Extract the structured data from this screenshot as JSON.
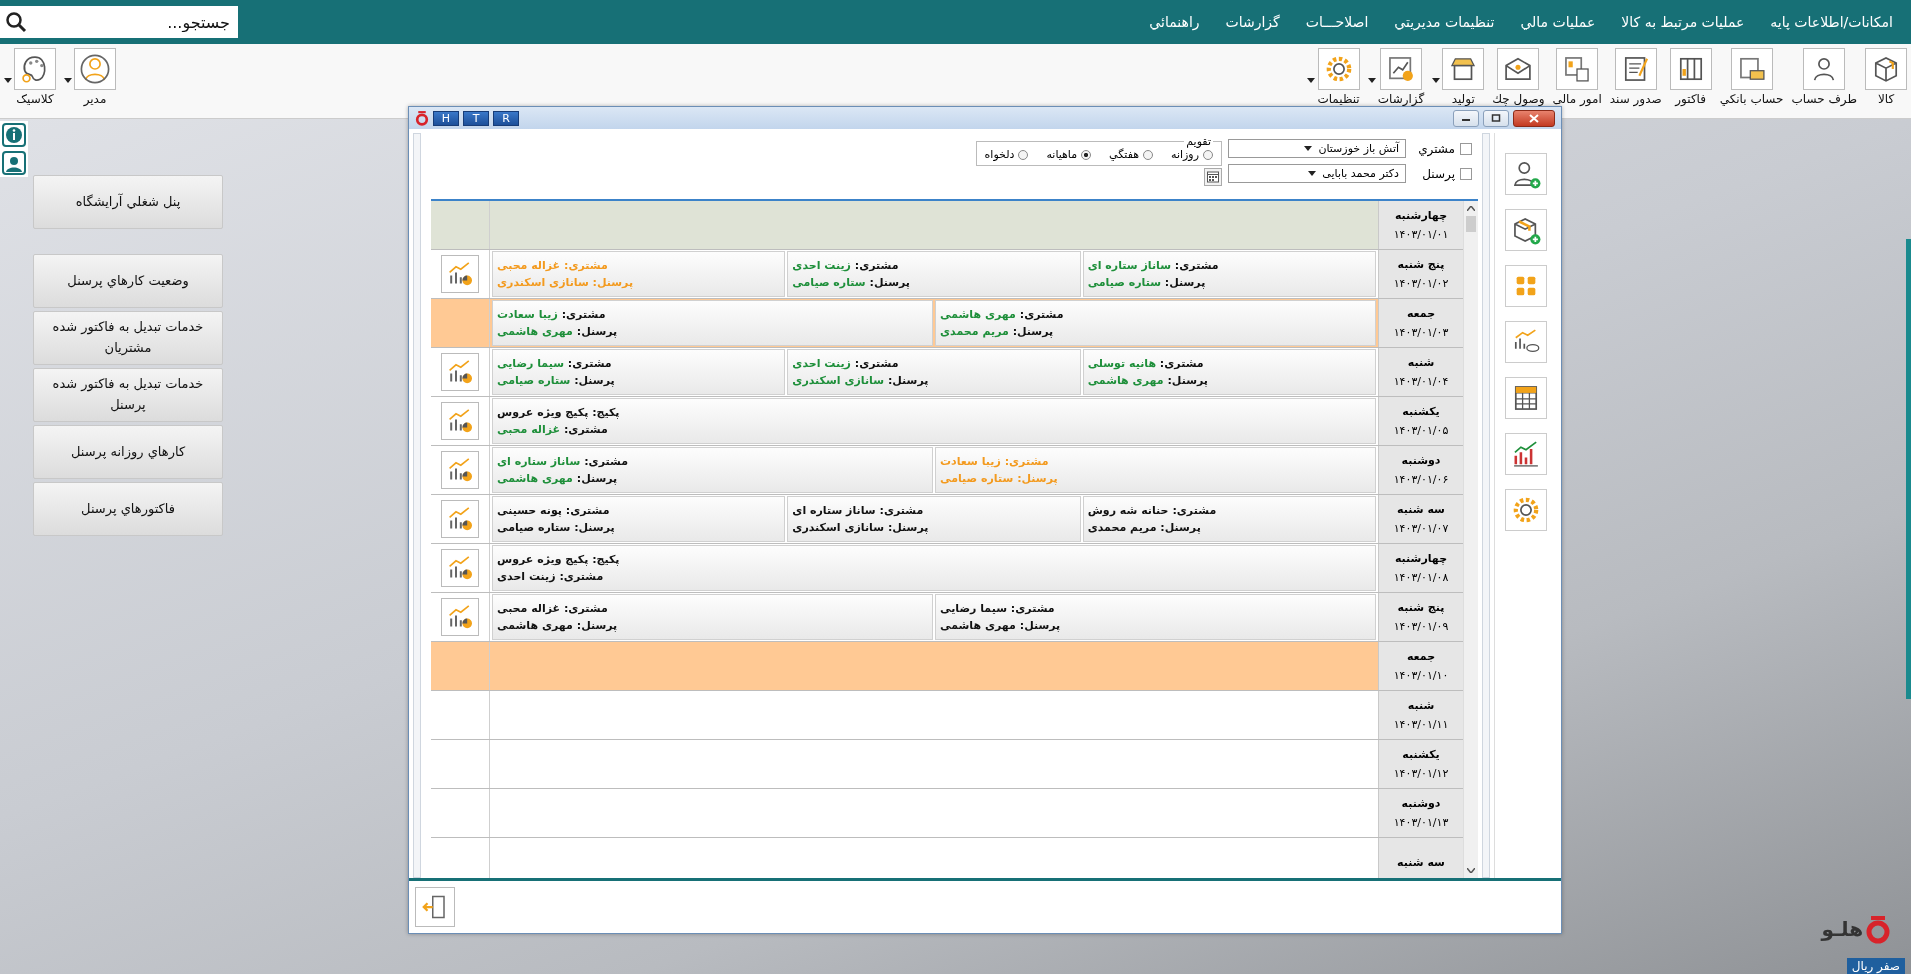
{
  "search": {
    "placeholder": "جستجو..."
  },
  "menu": [
    "امکانات/اطلاعات پایه",
    "عمليات مرتبط به کالا",
    "عمليات مالي",
    "تنظيمات مديريتي",
    "اصلاحـــات",
    "گزارشات",
    "راهنمائي"
  ],
  "toolbar": [
    {
      "label": "کالا",
      "dropdown": false
    },
    {
      "label": "طرف حساب",
      "dropdown": false
    },
    {
      "label": "حساب بانکي",
      "dropdown": false
    },
    {
      "label": "فاکتور",
      "dropdown": false
    },
    {
      "label": "صدور سند",
      "dropdown": false
    },
    {
      "label": "امور مالی",
      "dropdown": false
    },
    {
      "label": "وصول چك",
      "dropdown": false
    },
    {
      "label": "توليد",
      "dropdown": true
    },
    {
      "label": "گزارشات",
      "dropdown": true
    },
    {
      "label": "تنظيمات",
      "dropdown": true
    }
  ],
  "user_tools": [
    {
      "label": "مدير",
      "dropdown": true
    },
    {
      "label": "کلاسيک",
      "dropdown": true
    }
  ],
  "side_buttons": [
    "پنل شغلي آرايشگاه",
    "وضعيت  کارهاي  پرسنل",
    "خدمات تبديل به فاکتور شده مشتريان",
    "خدمات تبديل به فاکتور شده پرسنل",
    "کارهاي  روزانه  پرسنل",
    "فاکتورهاي پرسنل"
  ],
  "window": {
    "title_buttons": [
      "R",
      "T",
      "H"
    ],
    "filters": [
      {
        "label": "مشتري",
        "checked": false,
        "value": "آتش باز خوزستان"
      },
      {
        "label": "پرسنل",
        "checked": false,
        "value": "دکتر محمد بابایی"
      }
    ],
    "calendar": {
      "title": "تقويم",
      "options": [
        {
          "label": "روزانه",
          "selected": false
        },
        {
          "label": "هفتگي",
          "selected": false
        },
        {
          "label": "ماهيانه",
          "selected": true
        },
        {
          "label": "دلخواه",
          "selected": false
        }
      ]
    },
    "rows": [
      {
        "day": "چهارشنبه",
        "date": "۱۴۰۳/۰۱/۰۱",
        "kind": "today",
        "report": false,
        "entries": []
      },
      {
        "day": "پنج شنبه",
        "date": "۱۴۰۳/۰۱/۰۲",
        "kind": "normal",
        "report": true,
        "entries": [
          [
            {
              "label": "مشتری:",
              "value": "ساناز ستاره ای",
              "kind": "confirmed"
            },
            {
              "label": "پرسنل:",
              "value": "ستاره صیامی",
              "kind": "confirmed"
            }
          ],
          [
            {
              "label": "مشتری:",
              "value": "زینت احدی",
              "kind": "confirmed"
            },
            {
              "label": "پرسنل:",
              "value": "ستاره صیامی",
              "kind": "confirmed"
            }
          ],
          [
            {
              "label": "مشتری:",
              "value": "غزاله محبی",
              "kind": "pending"
            },
            {
              "label": "پرسنل:",
              "value": "سانازی اسکندری",
              "kind": "pending"
            }
          ]
        ]
      },
      {
        "day": "جمعه",
        "date": "۱۴۰۳/۰۱/۰۳",
        "kind": "holiday",
        "report": false,
        "entries": [
          [
            {
              "label": "مشتری:",
              "value": "مهری هاشمی",
              "kind": "confirmed"
            },
            {
              "label": "پرسنل:",
              "value": "مریم محمدی",
              "kind": "confirmed"
            }
          ],
          [
            {
              "label": "مشتری:",
              "value": "زیبا سعادت",
              "kind": "confirmed"
            },
            {
              "label": "پرسنل:",
              "value": "مهری هاشمی",
              "kind": "confirmed"
            }
          ]
        ]
      },
      {
        "day": "شنبه",
        "date": "۱۴۰۳/۰۱/۰۴",
        "kind": "normal",
        "report": true,
        "entries": [
          [
            {
              "label": "مشتری:",
              "value": "هانیه توسلی",
              "kind": "confirmed"
            },
            {
              "label": "پرسنل:",
              "value": "مهری هاشمی",
              "kind": "confirmed"
            }
          ],
          [
            {
              "label": "مشتری:",
              "value": "زینت احدی",
              "kind": "confirmed"
            },
            {
              "label": "پرسنل:",
              "value": "سانازی اسکندری",
              "kind": "confirmed"
            }
          ],
          [
            {
              "label": "مشتری:",
              "value": "سیما رضایی",
              "kind": "confirmed"
            },
            {
              "label": "پرسنل:",
              "value": "ستاره صیامی",
              "kind": "confirmed"
            }
          ]
        ]
      },
      {
        "day": "یکشنبه",
        "date": "۱۴۰۳/۰۱/۰۵",
        "kind": "normal",
        "report": true,
        "entries": [
          [
            {
              "label": "پکیج:",
              "value": "پکیج ویژه عروس",
              "kind": "plain"
            },
            {
              "label": "مشتری:",
              "value": "غزاله محبی",
              "kind": "confirmed"
            }
          ]
        ]
      },
      {
        "day": "دوشنبه",
        "date": "۱۴۰۳/۰۱/۰۶",
        "kind": "normal",
        "report": true,
        "entries": [
          [
            {
              "label": "مشتری:",
              "value": "زیبا سعادت",
              "kind": "pending"
            },
            {
              "label": "پرسنل:",
              "value": "ستاره صیامی",
              "kind": "pending"
            }
          ],
          [
            {
              "label": "مشتری:",
              "value": "ساناز ستاره ای",
              "kind": "confirmed"
            },
            {
              "label": "پرسنل:",
              "value": "مهری هاشمی",
              "kind": "confirmed"
            }
          ]
        ]
      },
      {
        "day": "سه شنبه",
        "date": "۱۴۰۳/۰۱/۰۷",
        "kind": "normal",
        "report": true,
        "entries": [
          [
            {
              "label": "مشتری:",
              "value": "حنانه شه روش",
              "kind": "plain"
            },
            {
              "label": "پرسنل:",
              "value": "مریم محمدی",
              "kind": "plain"
            }
          ],
          [
            {
              "label": "مشتری:",
              "value": "ساناز ستاره ای",
              "kind": "plain"
            },
            {
              "label": "پرسنل:",
              "value": "سانازی اسکندری",
              "kind": "plain"
            }
          ],
          [
            {
              "label": "مشتری:",
              "value": "پونه حسینی",
              "kind": "plain"
            },
            {
              "label": "پرسنل:",
              "value": "ستاره صیامی",
              "kind": "plain"
            }
          ]
        ]
      },
      {
        "day": "چهارشنبه",
        "date": "۱۴۰۳/۰۱/۰۸",
        "kind": "normal",
        "report": true,
        "entries": [
          [
            {
              "label": "پکیج:",
              "value": "پکیج ویژه عروس",
              "kind": "plain"
            },
            {
              "label": "مشتری:",
              "value": "زینت احدی",
              "kind": "plain"
            }
          ]
        ]
      },
      {
        "day": "پنج شنبه",
        "date": "۱۴۰۳/۰۱/۰۹",
        "kind": "normal",
        "report": true,
        "entries": [
          [
            {
              "label": "مشتری:",
              "value": "سیما رضایی",
              "kind": "plain"
            },
            {
              "label": "پرسنل:",
              "value": "مهری هاشمی",
              "kind": "plain"
            }
          ],
          [
            {
              "label": "مشتری:",
              "value": "غزاله محبی",
              "kind": "plain"
            },
            {
              "label": "پرسنل:",
              "value": "مهری هاشمی",
              "kind": "plain"
            }
          ]
        ]
      },
      {
        "day": "جمعه",
        "date": "۱۴۰۳/۰۱/۱۰",
        "kind": "holiday",
        "report": false,
        "entries": []
      },
      {
        "day": "شنبه",
        "date": "۱۴۰۳/۰۱/۱۱",
        "kind": "normal",
        "report": false,
        "entries": []
      },
      {
        "day": "یکشنبه",
        "date": "۱۴۰۳/۰۱/۱۲",
        "kind": "normal",
        "report": false,
        "entries": []
      },
      {
        "day": "دوشنبه",
        "date": "۱۴۰۳/۰۱/۱۳",
        "kind": "normal",
        "report": false,
        "entries": []
      },
      {
        "day": "سه شنبه",
        "kind": "normal",
        "report": false,
        "entries": []
      }
    ]
  },
  "logo": {
    "text": "هلـو"
  },
  "currency_badge": "صفر ريال"
}
